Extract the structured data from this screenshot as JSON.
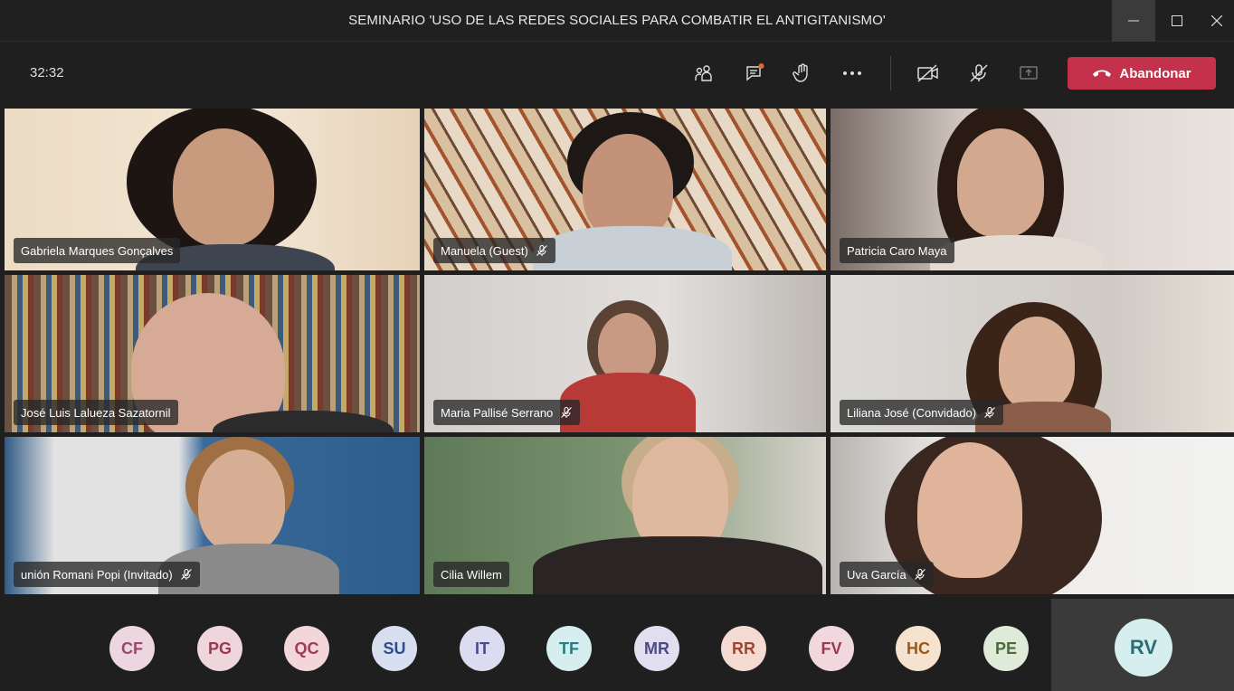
{
  "window": {
    "title": "SEMINARIO 'USO DE LAS REDES SOCIALES PARA COMBATIR EL ANTIGITANISMO'"
  },
  "toolbar": {
    "timer": "32:32",
    "leave_label": "Abandonar",
    "icons": [
      "participants-icon",
      "chat-icon",
      "raise-hand-icon",
      "more-icon",
      "camera-off-icon",
      "mic-off-icon",
      "share-screen-icon"
    ]
  },
  "participants": [
    {
      "name": "Gabriela Marques Gonçalves",
      "muted": false
    },
    {
      "name": "Manuela (Guest)",
      "muted": true
    },
    {
      "name": "Patricia Caro Maya",
      "muted": false
    },
    {
      "name": "José Luis Lalueza Sazatornil",
      "muted": false
    },
    {
      "name": "Maria Pallisé Serrano",
      "muted": true
    },
    {
      "name": "Liliana José (Convidado)",
      "muted": true
    },
    {
      "name": "unión Romani Popi (Invitado)",
      "muted": true
    },
    {
      "name": "Cilia Willem",
      "muted": false
    },
    {
      "name": "Uva García",
      "muted": true
    }
  ],
  "avatars": [
    {
      "initials": "CF",
      "bg": "#ecd6e0",
      "fg": "#9a4a6c"
    },
    {
      "initials": "PG",
      "bg": "#efd6dc",
      "fg": "#9a3a52"
    },
    {
      "initials": "QC",
      "bg": "#f3d6da",
      "fg": "#a23c4e"
    },
    {
      "initials": "SU",
      "bg": "#d7dff0",
      "fg": "#2f4f8a"
    },
    {
      "initials": "IT",
      "bg": "#dcdcf0",
      "fg": "#4a4a90"
    },
    {
      "initials": "TF",
      "bg": "#d6eef0",
      "fg": "#2a7c80"
    },
    {
      "initials": "MR",
      "bg": "#e0deef",
      "fg": "#4b4a85"
    },
    {
      "initials": "RR",
      "bg": "#f3dbd4",
      "fg": "#a0442c"
    },
    {
      "initials": "FV",
      "bg": "#f0d8de",
      "fg": "#9a3a55"
    },
    {
      "initials": "HC",
      "bg": "#f5e3cf",
      "fg": "#9a5a1c"
    },
    {
      "initials": "PE",
      "bg": "#dfead8",
      "fg": "#4c6b3c"
    }
  ],
  "self_avatar": {
    "initials": "RV",
    "bg": "#d6eeee",
    "fg": "#2c6e73"
  }
}
